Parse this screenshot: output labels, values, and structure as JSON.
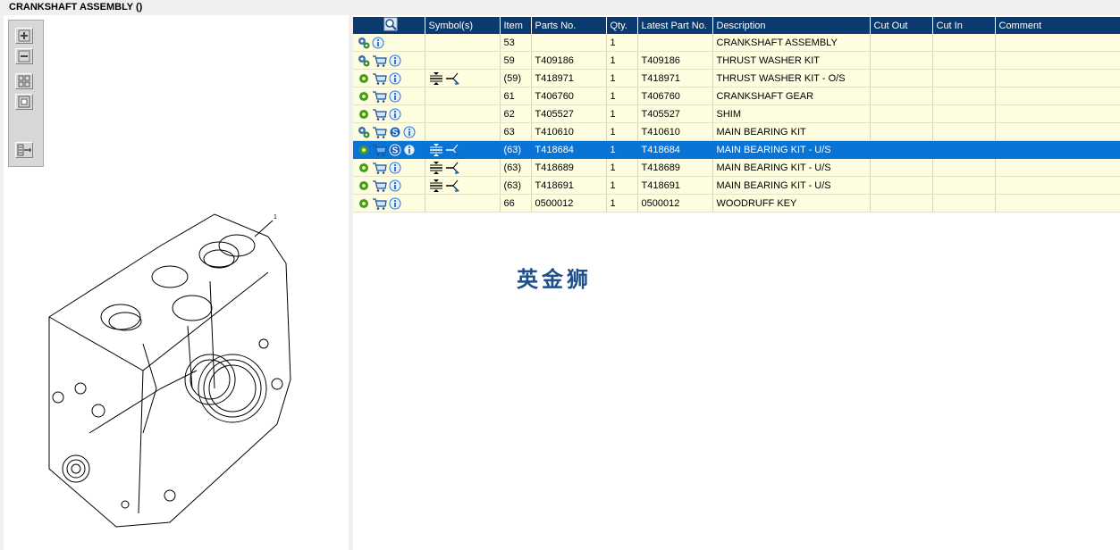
{
  "window": {
    "title": "CRANKSHAFT ASSEMBLY ()"
  },
  "drawing": {
    "callout": "1"
  },
  "watermark": "英金狮",
  "table": {
    "columns": [
      "",
      "Symbol(s)",
      "Item",
      "Parts No.",
      "Qty.",
      "Latest Part No.",
      "Description",
      "Cut Out",
      "Cut In",
      "Comment"
    ],
    "rows": [
      {
        "icons": [
          "gears-icon",
          "info-icon"
        ],
        "symbols": [],
        "item": "53",
        "part": "",
        "qty": "1",
        "latest": "",
        "desc": "CRANKSHAFT ASSEMBLY",
        "selected": false
      },
      {
        "icons": [
          "gears-icon",
          "cart-icon",
          "info-icon"
        ],
        "symbols": [],
        "item": "59",
        "part": "T409186",
        "qty": "1",
        "latest": "T409186",
        "desc": "THRUST WASHER KIT",
        "selected": false
      },
      {
        "icons": [
          "gear-icon",
          "cart-icon",
          "info-icon"
        ],
        "symbols": [
          "compress-icon",
          "replace-arrow-icon"
        ],
        "item": "(59)",
        "part": "T418971",
        "qty": "1",
        "latest": "T418971",
        "desc": "THRUST WASHER KIT - O/S",
        "selected": false
      },
      {
        "icons": [
          "gear-icon",
          "cart-icon",
          "info-icon"
        ],
        "symbols": [],
        "item": "61",
        "part": "T406760",
        "qty": "1",
        "latest": "T406760",
        "desc": "CRANKSHAFT GEAR",
        "selected": false
      },
      {
        "icons": [
          "gear-icon",
          "cart-icon",
          "info-icon"
        ],
        "symbols": [],
        "item": "62",
        "part": "T405527",
        "qty": "1",
        "latest": "T405527",
        "desc": "SHIM",
        "selected": false
      },
      {
        "icons": [
          "gears-icon",
          "cart-icon",
          "s-icon",
          "info-icon"
        ],
        "symbols": [],
        "item": "63",
        "part": "T410610",
        "qty": "1",
        "latest": "T410610",
        "desc": "MAIN BEARING KIT",
        "selected": false
      },
      {
        "icons": [
          "gear-icon",
          "cart-icon",
          "s-icon",
          "info-icon"
        ],
        "symbols": [
          "compress-icon",
          "replace-arrow-icon"
        ],
        "item": "(63)",
        "part": "T418684",
        "qty": "1",
        "latest": "T418684",
        "desc": "MAIN BEARING KIT - U/S",
        "selected": true
      },
      {
        "icons": [
          "gear-icon",
          "cart-icon",
          "info-icon"
        ],
        "symbols": [
          "compress-icon",
          "replace-arrow-icon"
        ],
        "item": "(63)",
        "part": "T418689",
        "qty": "1",
        "latest": "T418689",
        "desc": "MAIN BEARING KIT - U/S",
        "selected": false
      },
      {
        "icons": [
          "gear-icon",
          "cart-icon",
          "info-icon"
        ],
        "symbols": [
          "compress-icon",
          "replace-arrow-icon"
        ],
        "item": "(63)",
        "part": "T418691",
        "qty": "1",
        "latest": "T418691",
        "desc": "MAIN BEARING KIT - U/S",
        "selected": false
      },
      {
        "icons": [
          "gear-icon",
          "cart-icon",
          "info-icon"
        ],
        "symbols": [],
        "item": "66",
        "part": "0500012",
        "qty": "1",
        "latest": "0500012",
        "desc": "WOODRUFF KEY",
        "selected": false
      }
    ]
  },
  "colors": {
    "header": "#0a3a6f",
    "row": "#fffde0",
    "selected": "#0a74d6",
    "info": "#2a7ad8",
    "gear": "#3a9c2a"
  }
}
